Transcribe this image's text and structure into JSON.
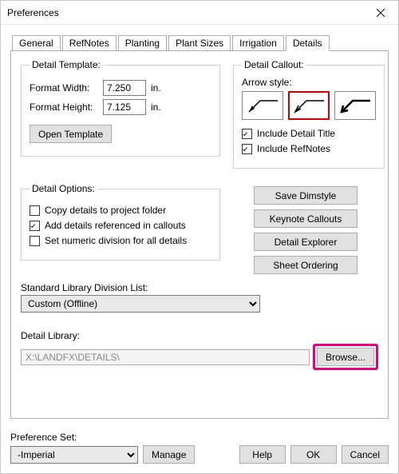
{
  "window": {
    "title": "Preferences"
  },
  "tabs": [
    "General",
    "RefNotes",
    "Planting",
    "Plant Sizes",
    "Irrigation",
    "Details"
  ],
  "active_tab": "Details",
  "detail_template": {
    "legend": "Detail Template:",
    "width_label": "Format Width:",
    "width_value": "7.250",
    "height_label": "Format Height:",
    "height_value": "7.125",
    "unit": "in.",
    "open_button": "Open Template"
  },
  "detail_callout": {
    "legend": "Detail Callout:",
    "arrow_label": "Arrow style:",
    "include_title_label": "Include Detail Title",
    "include_title_checked": true,
    "include_refnotes_label": "Include RefNotes",
    "include_refnotes_checked": true,
    "selected_arrow_index": 1
  },
  "detail_options": {
    "legend": "Detail Options:",
    "copy_label": "Copy details to project folder",
    "copy_checked": false,
    "add_ref_label": "Add details referenced in callouts",
    "add_ref_checked": true,
    "numeric_label": "Set numeric division for all details",
    "numeric_checked": false
  },
  "action_buttons": {
    "save_dimstyle": "Save Dimstyle",
    "keynote_callouts": "Keynote Callouts",
    "detail_explorer": "Detail Explorer",
    "sheet_ordering": "Sheet Ordering"
  },
  "std_library": {
    "label": "Standard Library Division List:",
    "value": "Custom (Offline)"
  },
  "detail_library": {
    "label": "Detail Library:",
    "path": "X:\\LANDFX\\DETAILS\\",
    "browse": "Browse..."
  },
  "preference_set": {
    "label": "Preference Set:",
    "value": "-Imperial",
    "manage": "Manage"
  },
  "footer": {
    "help": "Help",
    "ok": "OK",
    "cancel": "Cancel"
  }
}
